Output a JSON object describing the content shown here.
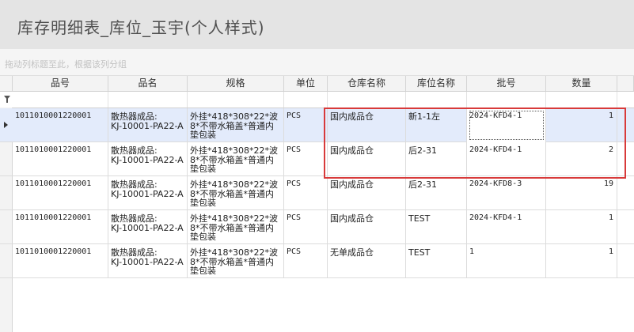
{
  "header": {
    "title": "库存明细表_库位_玉宇(个人样式)"
  },
  "group_panel": {
    "hint": "拖动列标题至此，根据该列分组"
  },
  "columns": [
    "品号",
    "品名",
    "规格",
    "单位",
    "仓库名称",
    "库位名称",
    "批号",
    "数量"
  ],
  "rows": [
    {
      "item_no": "1011010001220001",
      "name": "散热器成品:\nKJ-10001-PA22-A",
      "spec": "外挂*418*308*22*波\n8*不带水箱盖*普通内\n垫包装",
      "unit": "PCS",
      "warehouse": "国内成品仓",
      "location": "新1-1左",
      "batch": "2024-KFD4-1",
      "qty": "1"
    },
    {
      "item_no": "1011010001220001",
      "name": "散热器成品:\nKJ-10001-PA22-A",
      "spec": "外挂*418*308*22*波\n8*不带水箱盖*普通内\n垫包装",
      "unit": "PCS",
      "warehouse": "国内成品仓",
      "location": "后2-31",
      "batch": "2024-KFD4-1",
      "qty": "2"
    },
    {
      "item_no": "1011010001220001",
      "name": "散热器成品:\nKJ-10001-PA22-A",
      "spec": "外挂*418*308*22*波\n8*不带水箱盖*普通内\n垫包装",
      "unit": "PCS",
      "warehouse": "国内成品仓",
      "location": "后2-31",
      "batch": "2024-KFD8-3",
      "qty": "19"
    },
    {
      "item_no": "1011010001220001",
      "name": "散热器成品:\nKJ-10001-PA22-A",
      "spec": "外挂*418*308*22*波\n8*不带水箱盖*普通内\n垫包装",
      "unit": "PCS",
      "warehouse": "国内成品仓",
      "location": "TEST",
      "batch": "2024-KFD4-1",
      "qty": "1"
    },
    {
      "item_no": "1011010001220001",
      "name": "散热器成品:\nKJ-10001-PA22-A",
      "spec": "外挂*418*308*22*波\n8*不带水箱盖*普通内\n垫包装",
      "unit": "PCS",
      "warehouse": "无单成品仓",
      "location": "TEST",
      "batch": "1",
      "qty": "1"
    }
  ],
  "selected_row": 0,
  "colors": {
    "selection": "#e3ebfb",
    "highlight_box": "#d83a3a"
  },
  "icons": {
    "filter": "filter-icon",
    "row_indicator": "current-row-arrow-icon"
  }
}
